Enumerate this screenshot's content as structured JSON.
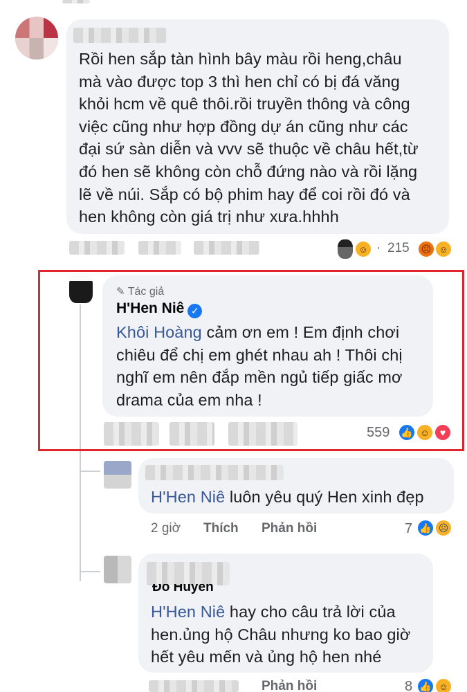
{
  "comment1": {
    "text_lines": [
      "Rồi hen sắp tàn hình bây màu rồi heng,châu",
      "mà vào được top 3 thì hen chỉ có bị đá văng",
      "khỏi hcm về quê thôi.rồi truyền thông và công",
      "việc cũng như hợp đồng dự án cũng như các",
      "đại sứ sàn diễn và vvv sẽ thuộc về châu hết,từ",
      "đó hen sẽ không còn chỗ đứng nào và rồi lặng",
      "lẽ về núi. Sắp có bộ phim hay để coi rồi đó và",
      "hen không còn giá trị như xưa.hhhh"
    ],
    "separator": "·",
    "reply_count": "215",
    "reactions": [
      "angry",
      "haha"
    ],
    "reply_preview_reaction": "haha"
  },
  "author_reply": {
    "badge": "Tác giả",
    "name": "H'Hen Niê",
    "mention": "Khôi Hoàng",
    "text_lines": [
      " cảm ơn em ! Em định chơi",
      "chiêu để chị em ghét nhau ah ! Thôi chị",
      "nghĩ em nên đắp mền ngủ tiếp giấc mơ",
      "drama của em nha !"
    ],
    "reaction_count": "559",
    "reactions": [
      "like",
      "haha",
      "love"
    ]
  },
  "reply2": {
    "mention": "H'Hen Niê",
    "text": " luôn yêu quý Hen xinh đẹp",
    "time": "2 giờ",
    "like_label": "Thích",
    "reply_label": "Phản hồi",
    "reaction_count": "7",
    "reactions": [
      "like",
      "sad"
    ]
  },
  "reply3": {
    "name_partial": "Đỗ Huyền",
    "mention": "H'Hen Niê",
    "text_lines": [
      " hay cho câu trả lời của",
      "hen.ủng hộ Châu nhưng ko bao giờ",
      "hết yêu mến và ủng hộ hen nhé"
    ],
    "reply_label": "Phản hồi",
    "reaction_count": "8"
  },
  "colors": {
    "bubble": "#f0f2f5",
    "link": "#385898",
    "highlight_border": "#e0252c",
    "verified": "#1877f2"
  }
}
